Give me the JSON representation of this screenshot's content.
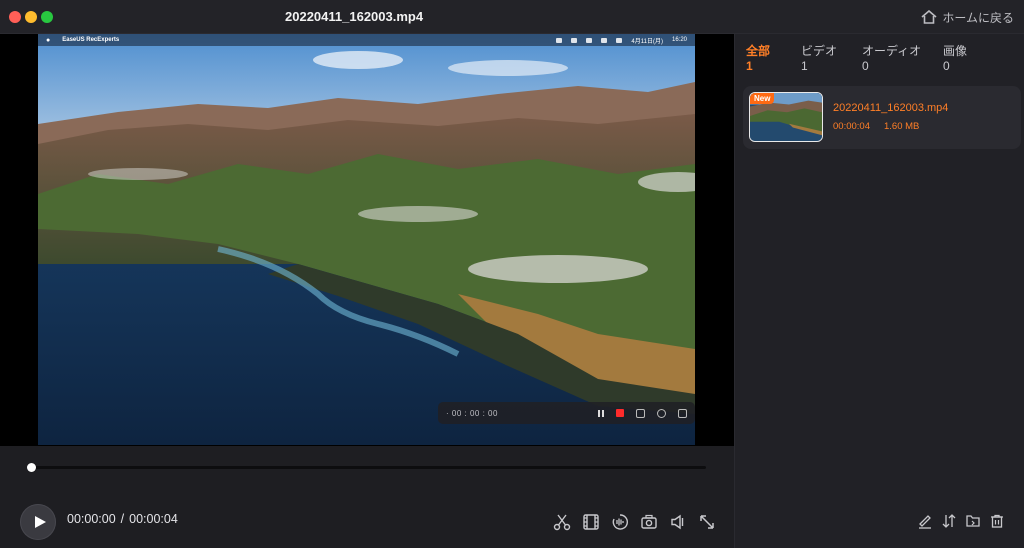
{
  "window": {
    "title": "20220411_162003.mp4",
    "home_label": "ホームに戻る"
  },
  "recording": {
    "menubar_app": "EaseUS RecExperts",
    "menubar_datetime": "4月11日(月)",
    "menubar_clock": "16:20",
    "toolbar_time": "· 00 : 00 : 00"
  },
  "player": {
    "current_time": "00:00:00",
    "separator": "/",
    "total_time": "00:00:04",
    "progress": 0
  },
  "tabs": [
    {
      "label": "全部",
      "count": "1",
      "active": true
    },
    {
      "label": "ビデオ",
      "count": "1",
      "active": false
    },
    {
      "label": "オーディオ",
      "count": "0",
      "active": false
    },
    {
      "label": "画像",
      "count": "0",
      "active": false
    }
  ],
  "files": [
    {
      "badge": "New",
      "name": "20220411_162003.mp4",
      "duration": "00:00:04",
      "size": "1.60 MB"
    }
  ],
  "icons": {
    "home": "home-icon",
    "play": "play-icon",
    "tools": [
      "scissors-icon",
      "film-strip-icon",
      "audio-icon",
      "camera-icon",
      "speaker-icon",
      "expand-icon"
    ],
    "panel_actions": [
      "edit-icon",
      "sort-icon",
      "folder-icon",
      "trash-icon"
    ]
  },
  "colors": {
    "accent": "#ff7f27",
    "record": "#ff2b2b",
    "background": "#1e1e22"
  }
}
